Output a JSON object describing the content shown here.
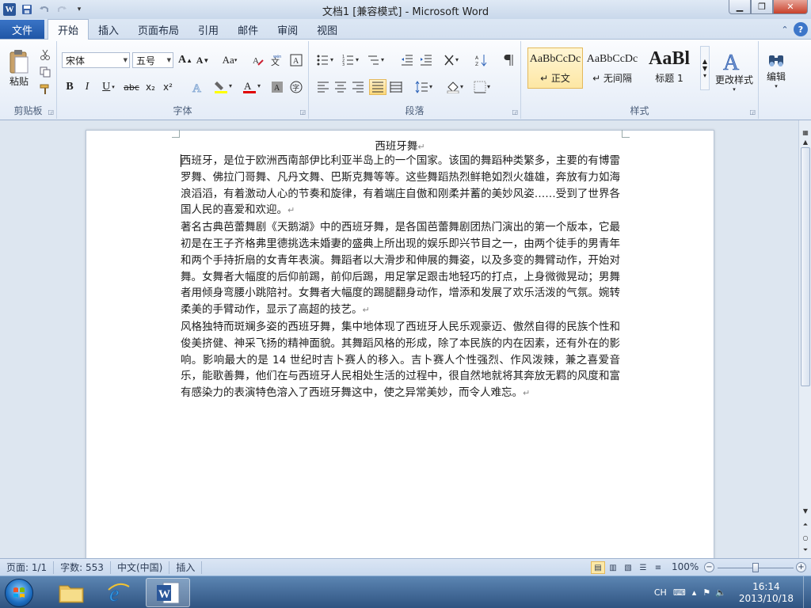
{
  "window": {
    "title": "文档1 [兼容模式] - Microsoft Word",
    "logo": "W"
  },
  "tabs": {
    "file": "文件",
    "items": [
      "开始",
      "插入",
      "页面布局",
      "引用",
      "邮件",
      "审阅",
      "视图"
    ],
    "active": "开始"
  },
  "ribbon": {
    "clipboard": {
      "label": "剪贴板",
      "paste": "粘贴"
    },
    "font": {
      "label": "字体",
      "font_name": "宋体",
      "font_size": "五号",
      "grow": "A",
      "shrink": "A",
      "case": "Aa",
      "bold": "B",
      "italic": "I",
      "underline": "U",
      "strike": "abc",
      "subscript": "x₂",
      "superscript": "x²",
      "highlight_color": "#ffff00",
      "font_color": "#e00000"
    },
    "paragraph": {
      "label": "段落"
    },
    "styles": {
      "label": "样式",
      "items": [
        {
          "preview": "AaBbCcDc",
          "name": "↵ 正文"
        },
        {
          "preview": "AaBbCcDc",
          "name": "↵ 无间隔"
        },
        {
          "preview": "AaBl",
          "name": "标题 1"
        }
      ],
      "change": "更改样式"
    },
    "editing": {
      "label": "编辑"
    }
  },
  "document": {
    "title": "西班牙舞",
    "paragraphs": [
      "西班牙，是位于欧洲西南部伊比利亚半岛上的一个国家。该国的舞蹈种类繁多，主要的有博雷罗舞、佛拉门哥舞、凡丹文舞、巴斯克舞等等。这些舞蹈热烈鲜艳如烈火雄雄，奔放有力如海浪滔滔，有着激动人心的节奏和旋律，有着端庄自傲和刚柔并蓄的美妙风姿……受到了世界各国人民的喜爱和欢迎。",
      "著名古典芭蕾舞剧《天鹅湖》中的西班牙舞，是各国芭蕾舞剧团热门演出的第一个版本，它最初是在王子齐格弗里德挑选未婚妻的盛典上所出现的娱乐即兴节目之一，由两个徒手的男青年和两个手持折扇的女青年表演。舞蹈者以大滑步和伸展的舞姿，以及多变的舞臂动作，开始对舞。女舞者大幅度的后仰前踢，前仰后踢，用足掌足跟击地轻巧的打点，上身微微晃动；男舞者用倾身弯腰小跳陪衬。女舞者大幅度的踢腿翻身动作，增添和发展了欢乐活泼的气氛。婉转柔美的手臂动作，显示了高超的技艺。",
      "风格独特而斑斓多姿的西班牙舞，集中地体现了西班牙人民乐观豪迈、傲然自得的民族个性和俊美挤健、神采飞扬的精神面貌。其舞蹈风格的形成，除了本民族的内在因素，还有外在的影响。影响最大的是 14 世纪时吉卜赛人的移入。吉卜赛人个性强烈、作风泼辣，兼之喜爱音乐，能歌善舞，他们在与西班牙人民相处生活的过程中，很自然地就将其奔放无羁的风度和富有感染力的表演特色溶入了西班牙舞这中，使之异常美妙，而令人难忘。"
    ],
    "para_mark": "↵"
  },
  "status": {
    "page": "页面: 1/1",
    "words": "字数: 553",
    "language": "中文(中国)",
    "insert": "插入",
    "zoom": "100%",
    "zoom_level": 0.5
  },
  "taskbar": {
    "ime": "CH",
    "time": "16:14",
    "date": "2013/10/18"
  }
}
